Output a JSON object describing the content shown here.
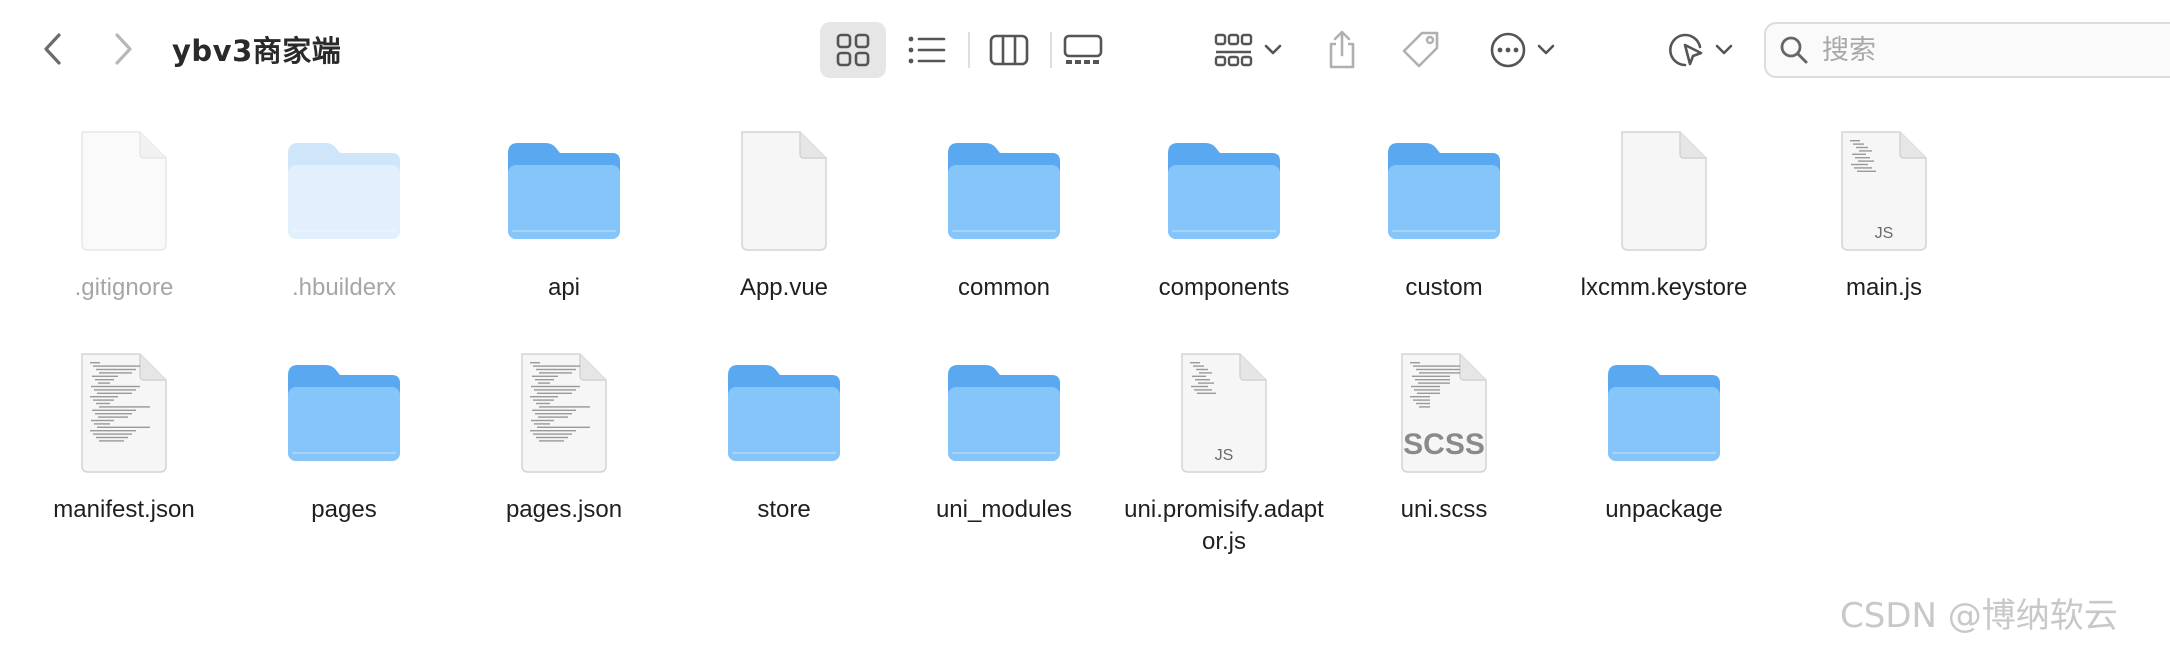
{
  "window": {
    "title": "ybv3商家端"
  },
  "toolbar": {
    "icons": {
      "back": "chevron-left-icon",
      "forward": "chevron-right-icon",
      "view_icons": "grid-view-icon",
      "view_list": "list-view-icon",
      "view_columns": "column-view-icon",
      "view_gallery": "gallery-view-icon",
      "group": "group-by-icon",
      "share": "share-icon",
      "tag": "tag-icon",
      "more": "more-actions-icon",
      "airdrop": "airdrop-icon"
    },
    "selected_view": "icons"
  },
  "search": {
    "placeholder": "搜索"
  },
  "files": [
    {
      "name": ".gitignore",
      "kind": "doc",
      "hidden": true
    },
    {
      "name": ".hbuilderx",
      "kind": "folder",
      "hidden": true
    },
    {
      "name": "api",
      "kind": "folder"
    },
    {
      "name": "App.vue",
      "kind": "doc"
    },
    {
      "name": "common",
      "kind": "folder"
    },
    {
      "name": "components",
      "kind": "folder"
    },
    {
      "name": "custom",
      "kind": "folder"
    },
    {
      "name": "lxcmm.keystore",
      "kind": "doc"
    },
    {
      "name": "main.js",
      "kind": "js",
      "badge": "JS"
    },
    {
      "name": "manifest.json",
      "kind": "code"
    },
    {
      "name": "pages",
      "kind": "folder"
    },
    {
      "name": "pages.json",
      "kind": "code"
    },
    {
      "name": "store",
      "kind": "folder"
    },
    {
      "name": "uni_modules",
      "kind": "folder"
    },
    {
      "name": "uni.promisify.adaptor.js",
      "kind": "js",
      "badge": "JS"
    },
    {
      "name": "uni.scss",
      "kind": "scss",
      "badge": "SCSS"
    },
    {
      "name": "unpackage",
      "kind": "folder"
    }
  ],
  "watermark": "CSDN @博纳软云",
  "colors": {
    "folder_back": "#5aa8ef",
    "folder_front": "#86c5f9",
    "folder_hidden_back": "#a9d0f5",
    "folder_hidden_front": "#c9e4fb",
    "icon_gray": "#6e6e6e"
  }
}
